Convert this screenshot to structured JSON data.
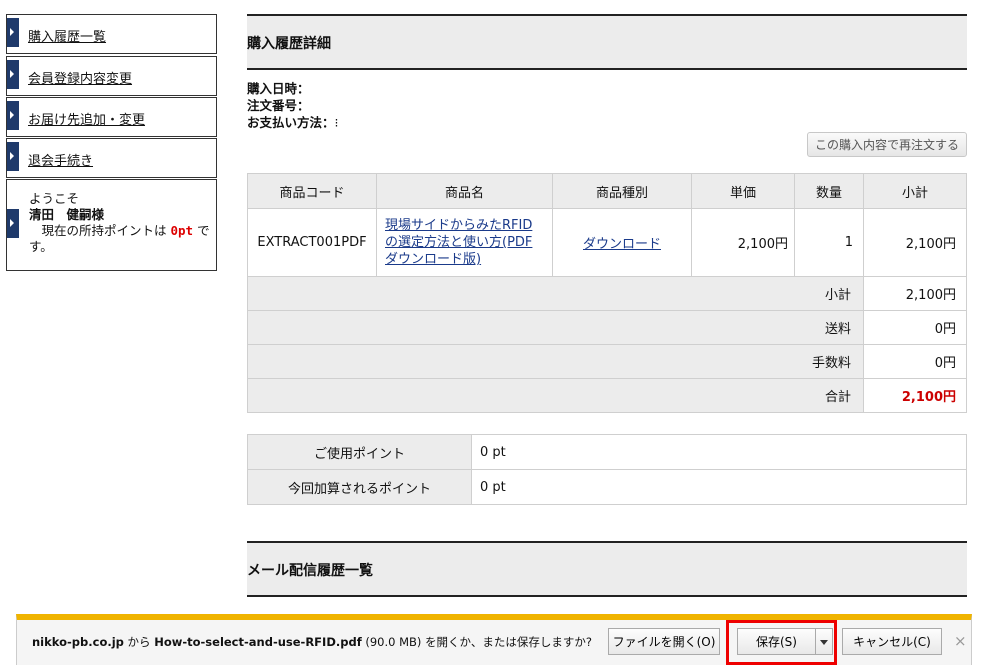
{
  "sidebar": {
    "items": [
      {
        "label": "購入履歴一覧"
      },
      {
        "label": "会員登録内容変更"
      },
      {
        "label": "お届け先追加・変更"
      },
      {
        "label": "退会手続き"
      }
    ],
    "welcome": {
      "greeting": "ようこそ",
      "name": "清田　健嗣様",
      "points_prefix": "　現在の所持ポイントは",
      "points": "0pt",
      "points_suffix": "で",
      "points_suffix2": "す。"
    }
  },
  "detail": {
    "title": "購入履歴詳細",
    "info": {
      "date_label": "購入日時：",
      "order_label": "注文番号：",
      "payment_label": "お支払い方法：",
      "payment_value": "⁝"
    },
    "reorder_label": "この購入内容で再注文する",
    "table": {
      "headers": [
        "商品コード",
        "商品名",
        "商品種別",
        "単価",
        "数量",
        "小計"
      ],
      "item": {
        "code": "EXTRACT001PDF",
        "name": "現場サイドからみたRFIDの選定方法と使い方(PDFダウンロード版)",
        "type": "ダウンロード",
        "price": "2,100円",
        "qty": "1",
        "subtotal": "2,100円"
      },
      "summary": [
        {
          "label": "小計",
          "value": "2,100円"
        },
        {
          "label": "送料",
          "value": "0円"
        },
        {
          "label": "手数料",
          "value": "0円"
        },
        {
          "label": "合計",
          "value": "2,100円"
        }
      ]
    },
    "points": [
      {
        "label": "ご使用ポイント",
        "value": "0 pt"
      },
      {
        "label": "今回加算されるポイント",
        "value": "0 pt"
      }
    ]
  },
  "mail": {
    "title": "メール配信履歴一覧"
  },
  "download_bar": {
    "site": "nikko-pb.co.jp",
    "from": "から",
    "file": "How-to-select-and-use-RFID.pdf",
    "size": "(90.0 MB)",
    "question": "を開くか、または保存しますか?",
    "open_label": "ファイルを開く(O)",
    "save_label": "保存(S)",
    "cancel_label": "キャンセル(C)",
    "close_glyph": "×"
  },
  "colors": {
    "accent_nav": "#1f3a6b",
    "total_red": "#cc0000",
    "bar_yellow": "#f0b400",
    "highlight": "#ee0000"
  }
}
